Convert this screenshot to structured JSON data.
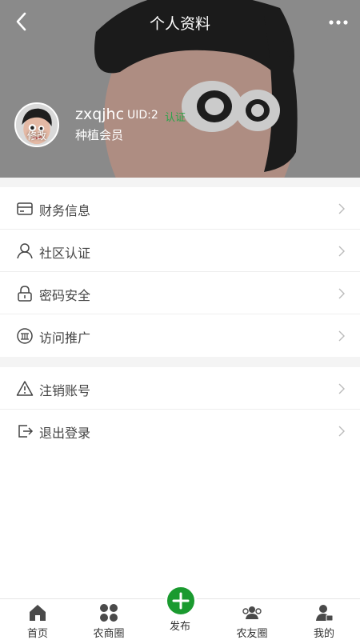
{
  "header": {
    "title": "个人资料",
    "back_icon": "chevron-left-icon",
    "more_icon": "more-dots-icon"
  },
  "profile": {
    "avatar_edit_label": "修改",
    "username": "zxqjhc",
    "uid": "UID:2",
    "status_tag": "认证",
    "member_level": "种植会员",
    "status_color": "#2aa54a"
  },
  "menu": {
    "group1": [
      {
        "label": "财务信息",
        "icon": "wallet-card-icon"
      },
      {
        "label": "社区认证",
        "icon": "user-icon"
      },
      {
        "label": "密码安全",
        "icon": "lock-icon"
      },
      {
        "label": "访问推广",
        "icon": "promotion-icon"
      }
    ],
    "group2": [
      {
        "label": "注销账号",
        "icon": "warning-icon"
      },
      {
        "label": "退出登录",
        "icon": "logout-icon"
      }
    ]
  },
  "tabbar": {
    "items": [
      {
        "label": "首页",
        "icon": "home-icon"
      },
      {
        "label": "农商圈",
        "icon": "grid-circle-icon"
      },
      {
        "label": "发布",
        "icon": "plus-icon"
      },
      {
        "label": "农友圈",
        "icon": "people-icon"
      },
      {
        "label": "我的",
        "icon": "person-icon"
      }
    ],
    "accent": "#1a9a2f"
  }
}
